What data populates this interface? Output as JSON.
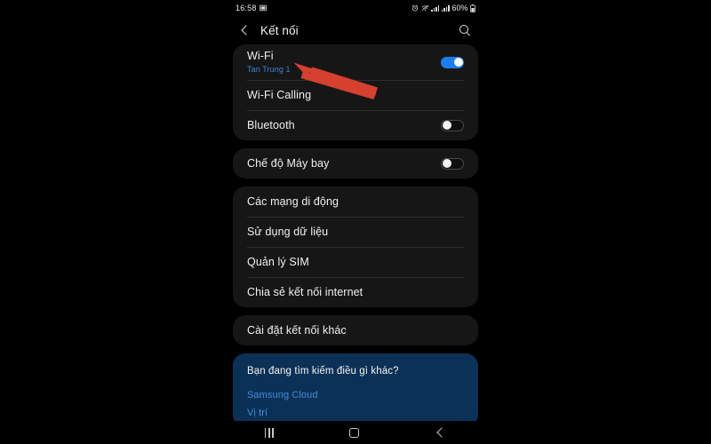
{
  "status_bar": {
    "clock": "16:58",
    "battery_percent": "60%",
    "icons": [
      "screenshot-icon",
      "alarm-icon",
      "wifi-muted-icon",
      "signal-bars-icon",
      "signal-bars-icon",
      "battery-icon"
    ]
  },
  "header": {
    "title": "Kết nối",
    "back_icon": "back-chevron-icon",
    "search_icon": "search-icon"
  },
  "sections": [
    {
      "name": "connectivity",
      "rows": [
        {
          "label": "Wi-Fi",
          "sub": "Tan Trung 1",
          "control": "toggle",
          "state": "on"
        },
        {
          "label": "Wi-Fi Calling",
          "sub": "",
          "control": "none",
          "state": ""
        },
        {
          "label": "Bluetooth",
          "sub": "",
          "control": "toggle",
          "state": "off"
        }
      ]
    },
    {
      "name": "airplane",
      "rows": [
        {
          "label": "Chế độ Máy bay",
          "sub": "",
          "control": "toggle",
          "state": "off"
        }
      ]
    },
    {
      "name": "mobile",
      "rows": [
        {
          "label": "Các mạng di động",
          "sub": "",
          "control": "none",
          "state": ""
        },
        {
          "label": "Sử dụng dữ liệu",
          "sub": "",
          "control": "none",
          "state": ""
        },
        {
          "label": "Quản lý SIM",
          "sub": "",
          "control": "none",
          "state": ""
        },
        {
          "label": "Chia sẻ kết nối internet",
          "sub": "",
          "control": "none",
          "state": ""
        }
      ]
    },
    {
      "name": "more-settings",
      "rows": [
        {
          "label": "Cài đặt kết nối khác",
          "sub": "",
          "control": "none",
          "state": ""
        }
      ]
    }
  ],
  "promo": {
    "title": "Bạn đang tìm kiếm điều gì khác?",
    "links": [
      "Samsung Cloud",
      "Vị trí"
    ]
  },
  "nav_bar": {
    "recents_icon": "recents-icon",
    "home_icon": "home-icon",
    "back_icon": "back-icon"
  },
  "annotation": {
    "type": "arrow",
    "color": "#d6402e",
    "target": "Wi-Fi"
  },
  "colors": {
    "screen_bg": "#000000",
    "card_bg": "#161616",
    "promo_bg": "#0c3156",
    "toggle_on": "#1a7ef0",
    "link_blue": "#3f8ce0",
    "subtitle_blue": "#3a84d8"
  }
}
